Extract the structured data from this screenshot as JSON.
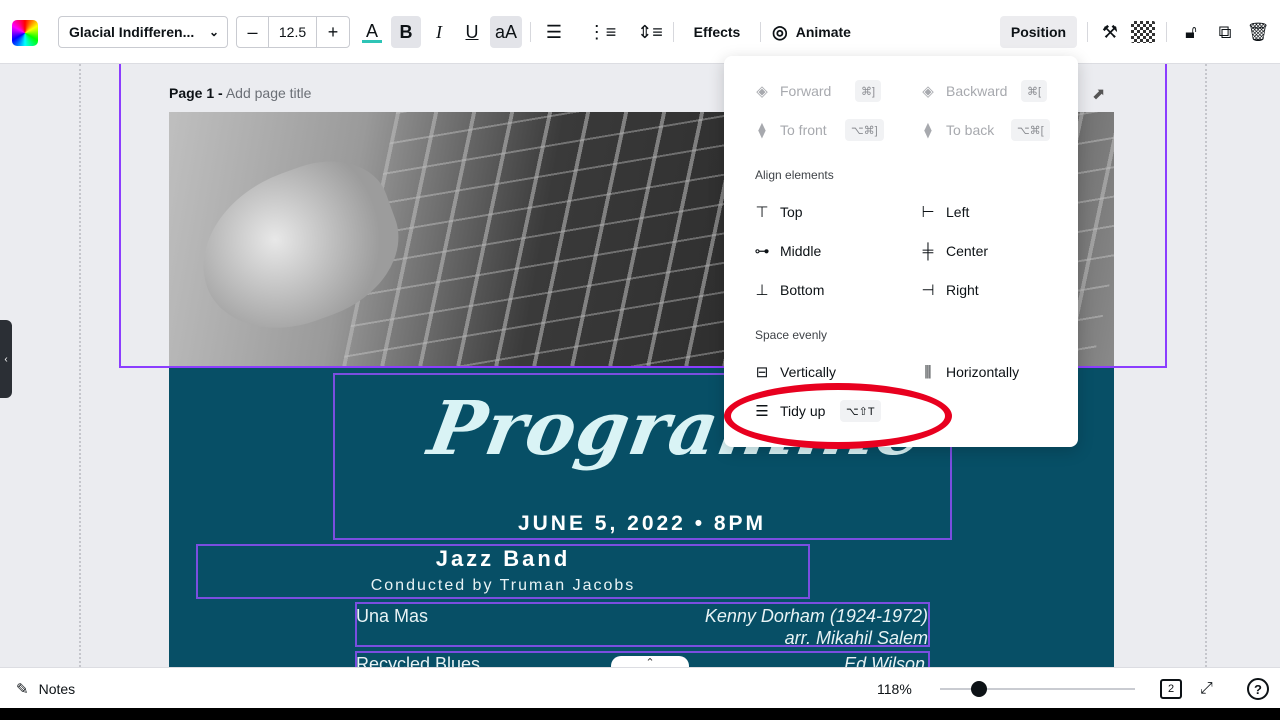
{
  "toolbar": {
    "font_name": "Glacial Indifferen...",
    "font_size": "12.5",
    "minus": "–",
    "plus": "+",
    "color_icon": "A",
    "bold": "B",
    "italic": "I",
    "underline": "U",
    "case": "aA",
    "effects": "Effects",
    "animate": "Animate",
    "position": "Position"
  },
  "page": {
    "title_prefix": "Page 1 -",
    "title_placeholder": "Add page title"
  },
  "poster": {
    "title": "Programme",
    "date": "JUNE 5, 2022 • 8PM",
    "band": "Jazz Band",
    "conductor": "Conducted by Truman Jacobs",
    "songs": [
      {
        "title": "Una Mas",
        "composer": "Kenny Dorham  (1924-1972)",
        "arranger": "arr. Mikahil Salem"
      },
      {
        "title": "Recycled Blues",
        "composer": "Ed Wilson"
      }
    ]
  },
  "position_menu": {
    "forward": "Forward",
    "forward_key": "⌘]",
    "backward": "Backward",
    "backward_key": "⌘[",
    "to_front": "To front",
    "to_front_key": "⌥⌘]",
    "to_back": "To back",
    "to_back_key": "⌥⌘[",
    "align_heading": "Align elements",
    "top": "Top",
    "left": "Left",
    "middle": "Middle",
    "center": "Center",
    "bottom": "Bottom",
    "right": "Right",
    "space_heading": "Space evenly",
    "vertically": "Vertically",
    "horizontally": "Horizontally",
    "tidy_up": "Tidy up",
    "tidy_up_key": "⌥⇧T"
  },
  "bottom": {
    "notes": "Notes",
    "zoom": "118%",
    "zoom_level": 0.2,
    "page_count": "2"
  },
  "colors": {
    "accent": "#8b3dff",
    "poster_bg": "#074f66",
    "annotation": "#e8001f"
  }
}
